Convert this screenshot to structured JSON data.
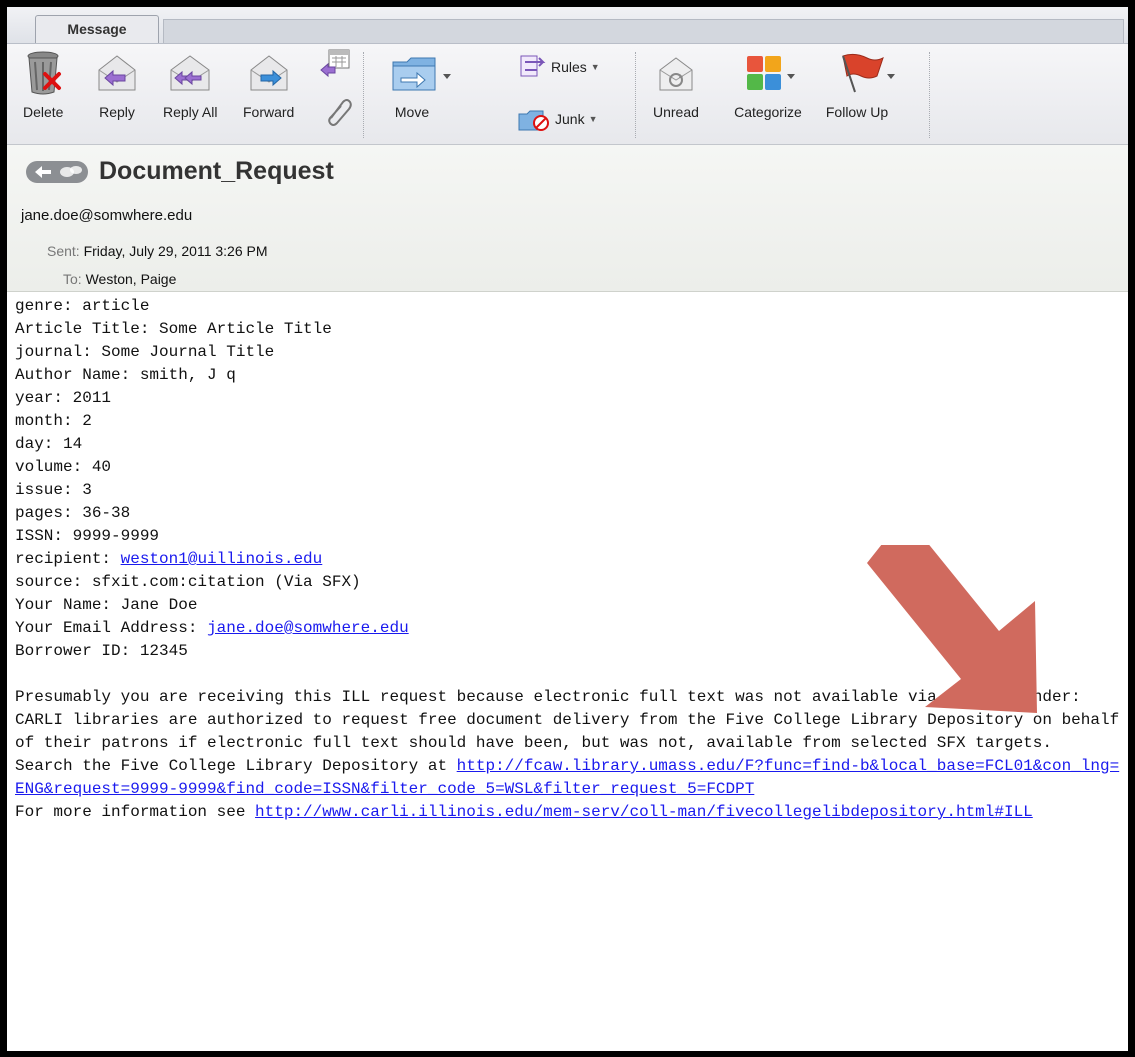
{
  "tab": {
    "label": "Message"
  },
  "toolbar": {
    "delete": "Delete",
    "reply": "Reply",
    "reply_all": "Reply All",
    "forward": "Forward",
    "move": "Move",
    "rules": "Rules",
    "junk": "Junk",
    "unread": "Unread",
    "categorize": "Categorize",
    "follow_up": "Follow Up"
  },
  "message": {
    "subject": "Document_Request",
    "from": "jane.doe@somwhere.edu",
    "sent_label": "Sent:",
    "sent_value": "Friday, July 29, 2011 3:26 PM",
    "to_label": "To:",
    "to_value": "Weston, Paige"
  },
  "body": {
    "genre": "genre: article",
    "article_title": "Article Title: Some Article Title",
    "journal": "journal: Some Journal Title",
    "author": "Author Name: smith, J q",
    "year": "year: 2011",
    "month": "month: 2",
    "day": "day: 14",
    "volume": "volume: 40",
    "issue": "issue: 3",
    "pages": "pages: 36-38",
    "issn": "ISSN: 9999-9999",
    "recipient_label": "recipient: ",
    "recipient_link": "weston1@uillinois.edu",
    "source": "source: sfxit.com:citation (Via SFX)",
    "your_name": "Your Name: Jane Doe",
    "email_label": "Your Email Address: ",
    "email_link": "jane.doe@somwhere.edu",
    "borrower": "Borrower ID: 12345",
    "paragraph": "Presumably you are receiving this ILL request because electronic full text was not available via SFX. Reminder: CARLI libraries are authorized to request free document delivery from the Five College Library Depository on behalf of their patrons if electronic full text should have been, but was not, available from selected SFX targets.",
    "search_label": "Search the Five College Library Depository at ",
    "search_link": "http://fcaw.library.umass.edu/F?func=find-b&local_base=FCL01&con_lng=ENG&request=9999-9999&find_code=ISSN&filter_code_5=WSL&filter_request_5=FCDPT",
    "info_label": "For more information see ",
    "info_link": "http://www.carli.illinois.edu/mem-serv/coll-man/fivecollegelibdepository.html#ILL"
  },
  "colors": {
    "arrow": "#d06a5e",
    "link": "#1a1aee"
  }
}
